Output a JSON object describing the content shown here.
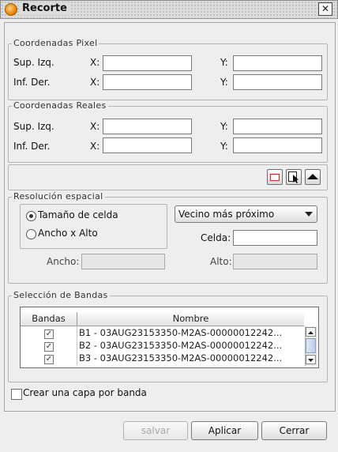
{
  "window": {
    "title": "Recorte",
    "close_glyph": "✕"
  },
  "pixel": {
    "legend": "Coordenadas Pixel",
    "row1_label": "Sup. Izq.",
    "row2_label": "Inf. Der.",
    "x_label": "X:",
    "y_label": "Y:",
    "sup_x": "",
    "sup_y": "",
    "inf_x": "",
    "inf_y": ""
  },
  "reales": {
    "legend": "Coordenadas Reales",
    "row1_label": "Sup. Izq.",
    "row2_label": "Inf. Der.",
    "x_label": "X:",
    "y_label": "Y:",
    "sup_x": "",
    "sup_y": "",
    "inf_x": "",
    "inf_y": ""
  },
  "tools": {
    "rect_icon": "rectangle-select-icon",
    "pointer_icon": "pointer-select-icon",
    "collapse_icon": "triangle-up-icon"
  },
  "resolucion": {
    "legend": "Resolución espacial",
    "option_cell": "Tamaño de celda",
    "option_wh": "Ancho x Alto",
    "selected_option": "Tamaño de celda",
    "interpolation": "Vecino más próximo",
    "celda_label": "Celda:",
    "celda_value": "",
    "ancho_label": "Ancho:",
    "alto_label": "Alto:",
    "ancho_value": "",
    "alto_value": ""
  },
  "bandas": {
    "legend": "Selección de Bandas",
    "columns": [
      "Bandas",
      "Nombre"
    ],
    "rows": [
      {
        "checked": true,
        "name": "B1 - 03AUG23153350-M2AS-00000012242..."
      },
      {
        "checked": true,
        "name": "B2 - 03AUG23153350-M2AS-00000012242..."
      },
      {
        "checked": true,
        "name": "B3 - 03AUG23153350-M2AS-00000012242..."
      }
    ]
  },
  "options": {
    "one_layer_per_band": "Crear una capa por banda",
    "one_layer_checked": false
  },
  "buttons": {
    "save": "salvar",
    "apply": "Aplicar",
    "close": "Cerrar"
  }
}
